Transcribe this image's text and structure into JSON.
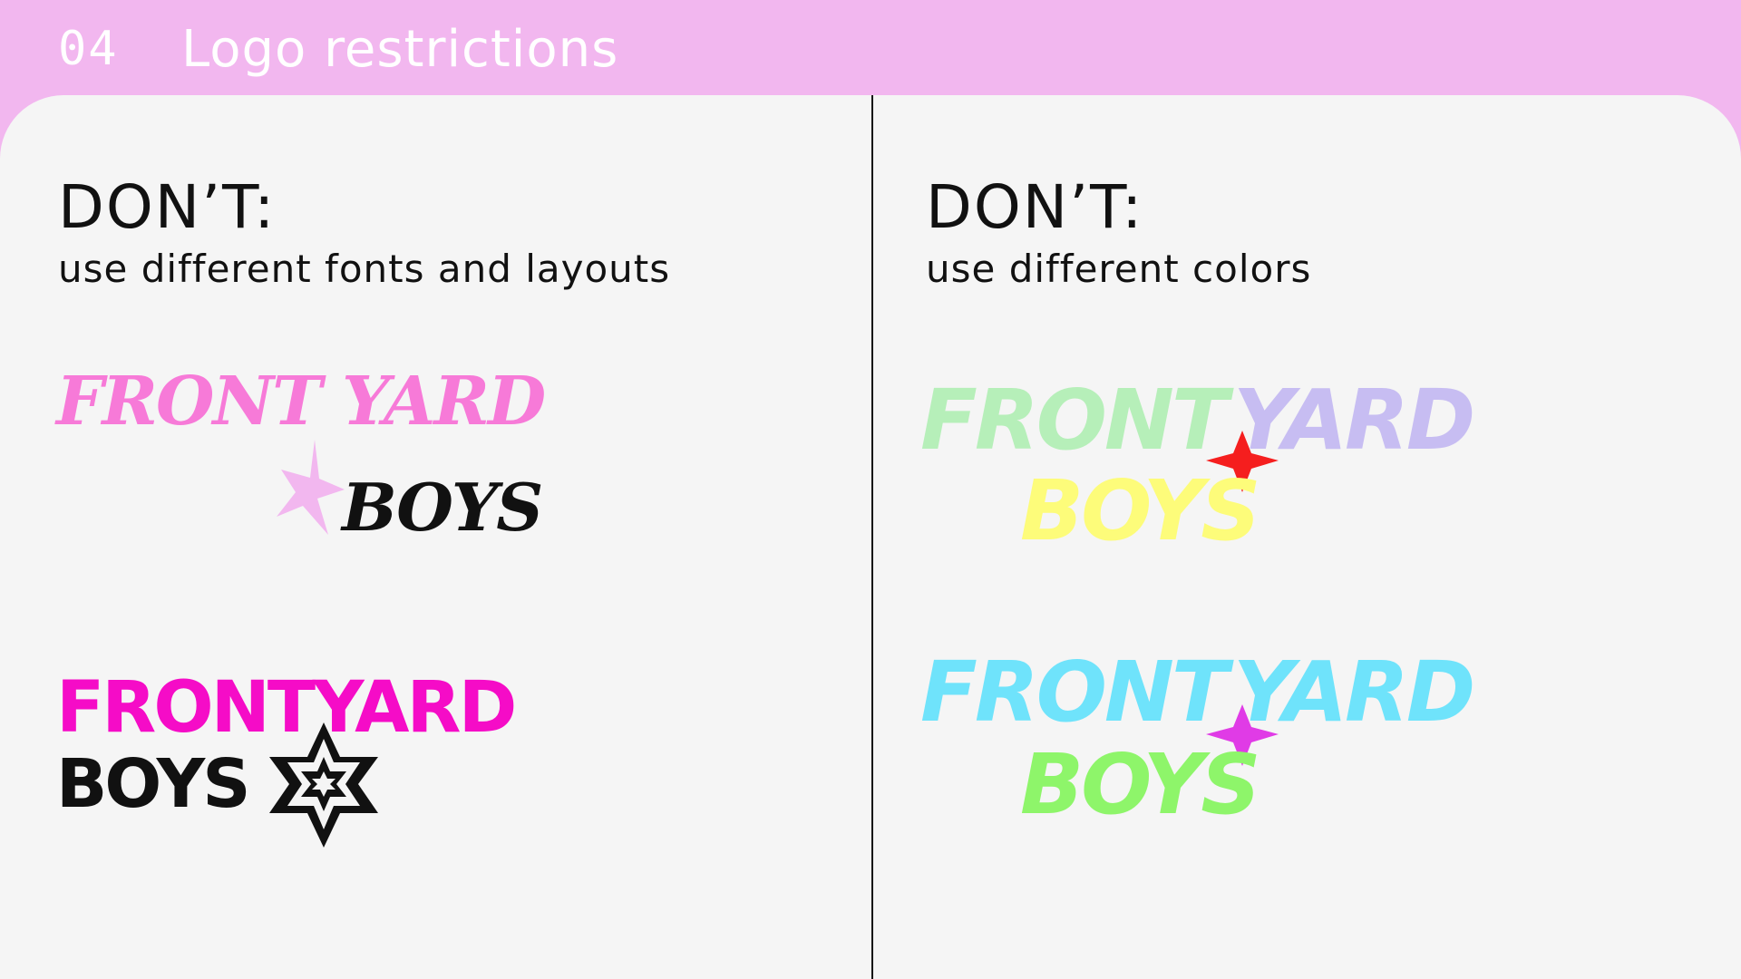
{
  "header": {
    "number": "04",
    "title": "Logo restrictions"
  },
  "left": {
    "heading": "DON’T:",
    "subheading": "use different fonts and layouts",
    "logo_a": {
      "line1": "FRONT YARD",
      "line2": "BOYS",
      "text_color": "#f77ad8",
      "line2_color": "#111111",
      "star_color": "#f2b7ef"
    },
    "logo_b": {
      "line1": "FRONTYARD",
      "line2": "BOYS",
      "line1_color": "#f50cc7",
      "line2_color": "#111111",
      "star_color": "#111111"
    }
  },
  "right": {
    "heading": "DON’T:",
    "subheading": "use different colors",
    "logo_a": {
      "line1a": "FRONT",
      "line1b": "YARD",
      "line2": "BOYS",
      "front_color": "#b6efb9",
      "yard_color": "#c7bdf2",
      "boys_color": "#fdfc7a",
      "star_color": "#f51e1e"
    },
    "logo_b": {
      "line1a": "FRONT",
      "line1b": "YARD",
      "line2": "BOYS",
      "front_color": "#6fe3fb",
      "yard_color": "#6fe3fb",
      "boys_color": "#8ef56a",
      "star_color": "#e03be6"
    }
  }
}
